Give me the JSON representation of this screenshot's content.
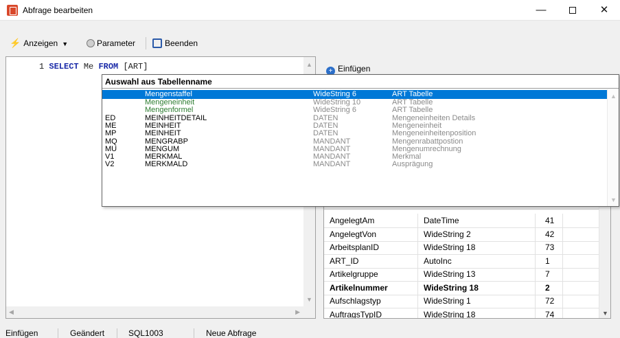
{
  "window": {
    "title": "Abfrage bearbeiten",
    "min_glyph": "—",
    "close_glyph": "✕"
  },
  "toolbar": {
    "anzeigen_label": "Anzeigen",
    "parameter_label": "Parameter",
    "beenden_label": "Beenden"
  },
  "editor": {
    "line_number": "1",
    "kw_select": "SELECT",
    "text_after_select": " Me",
    "kw_from": "FROM",
    "text_after_from": " [ART]"
  },
  "right_panel": {
    "einfuegen_label": "Einfügen"
  },
  "popup": {
    "title": "Auswahl aus Tabellenname",
    "items": [
      {
        "code": "",
        "name": "Mengenstaffel",
        "type": "WideString  6",
        "desc": "ART Tabelle",
        "selected": true,
        "green": true
      },
      {
        "code": "",
        "name": "Mengeneinheit",
        "type": "WideString  10",
        "desc": "ART Tabelle",
        "selected": false,
        "green": true
      },
      {
        "code": "",
        "name": "Mengenformel",
        "type": "WideString  6",
        "desc": "ART Tabelle",
        "selected": false,
        "green": true
      },
      {
        "code": "ED",
        "name": "MEINHEITDETAIL",
        "type": "DATEN",
        "desc": "Mengeneinheiten Details",
        "selected": false,
        "green": false
      },
      {
        "code": "ME",
        "name": "MEINHEIT",
        "type": "DATEN",
        "desc": "Mengeneinheit",
        "selected": false,
        "green": false
      },
      {
        "code": "MP",
        "name": "MEINHEIT",
        "type": "DATEN",
        "desc": "Mengeneinheitenposition",
        "selected": false,
        "green": false
      },
      {
        "code": "MQ",
        "name": "MENGRABP",
        "type": "MANDANT",
        "desc": "Mengenrabattpostion",
        "selected": false,
        "green": false
      },
      {
        "code": "MU",
        "name": "MENGUM",
        "type": "MANDANT",
        "desc": "Mengenumrechnung",
        "selected": false,
        "green": false
      },
      {
        "code": "V1",
        "name": "MERKMAL",
        "type": "MANDANT",
        "desc": "Merkmal",
        "selected": false,
        "green": false
      },
      {
        "code": "V2",
        "name": "MERKMALD",
        "type": "MANDANT",
        "desc": "Ausprägung",
        "selected": false,
        "green": false
      }
    ]
  },
  "grid": {
    "rows": [
      {
        "field": "AngelegtAm",
        "type": "DateTime",
        "num": "41",
        "bold": false
      },
      {
        "field": "AngelegtVon",
        "type": "WideString  2",
        "num": "42",
        "bold": false
      },
      {
        "field": "ArbeitsplanID",
        "type": "WideString  18",
        "num": "73",
        "bold": false
      },
      {
        "field": "ART_ID",
        "type": "AutoInc",
        "num": "1",
        "bold": false
      },
      {
        "field": "Artikelgruppe",
        "type": "WideString  13",
        "num": "7",
        "bold": false
      },
      {
        "field": "Artikelnummer",
        "type": "WideString  18",
        "num": "2",
        "bold": true
      },
      {
        "field": "Aufschlagstyp",
        "type": "WideString  1",
        "num": "72",
        "bold": false
      },
      {
        "field": "AuftragsTypID",
        "type": "WideString  18",
        "num": "74",
        "bold": false
      }
    ]
  },
  "status": {
    "s1": "Einfügen",
    "s2": "Geändert",
    "s3": "SQL1003",
    "s4": "Neue Abfrage"
  }
}
